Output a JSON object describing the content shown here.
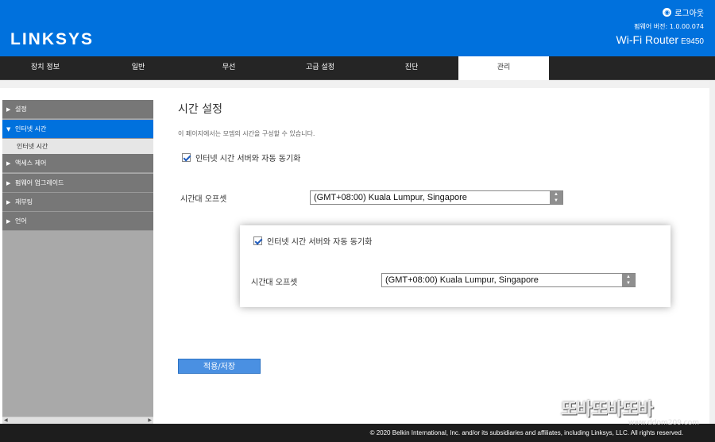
{
  "header": {
    "logo": "LINKSYS",
    "logout_label": "로그아웃",
    "firmware": "펌웨어 버전: 1.0.00.074",
    "product": "Wi-Fi Router",
    "model": "E9450"
  },
  "nav": {
    "tabs": [
      {
        "label": "장치 정보"
      },
      {
        "label": "일반"
      },
      {
        "label": "무선"
      },
      {
        "label": "고급 설정"
      },
      {
        "label": "진단"
      },
      {
        "label": "관리"
      }
    ],
    "active_index": 5
  },
  "sidebar": {
    "items": [
      {
        "label": "설정"
      },
      {
        "label": "인터넷 시간"
      },
      {
        "label": "액세스 제어"
      },
      {
        "label": "펌웨어 업그레이드"
      },
      {
        "label": "재부팅"
      },
      {
        "label": "언어"
      }
    ],
    "sub_item": "인터넷 시간"
  },
  "main": {
    "title": "시간 설정",
    "description": "이 페이지에서는 모뎀의 시간을 구성할 수 있습니다.",
    "auto_sync_label": "인터넷 시간 서버와 자동 동기화",
    "auto_sync_checked": true,
    "timezone_label": "시간대 오프셋",
    "timezone_value": "(GMT+08:00) Kuala Lumpur, Singapore",
    "apply_label": "적용/저장"
  },
  "zoom": {
    "auto_sync_label": "인터넷 시간 서버와 자동 동기화",
    "timezone_label": "시간대 오프셋",
    "timezone_value": "(GMT+08:00) Kuala Lumpur, Singapore"
  },
  "footer": {
    "copyright": "© 2020 Belkin International, Inc. and/or its subsidiaries and affiliates, including Linksys, LLC. All rights reserved."
  },
  "watermark": {
    "text": "또바또바또바",
    "url": "www.ddom209.com"
  },
  "colors": {
    "brand_blue": "#0071dd",
    "nav_dark": "#252525",
    "sidebar_gray": "#777777",
    "apply_blue": "#4a90e2"
  }
}
